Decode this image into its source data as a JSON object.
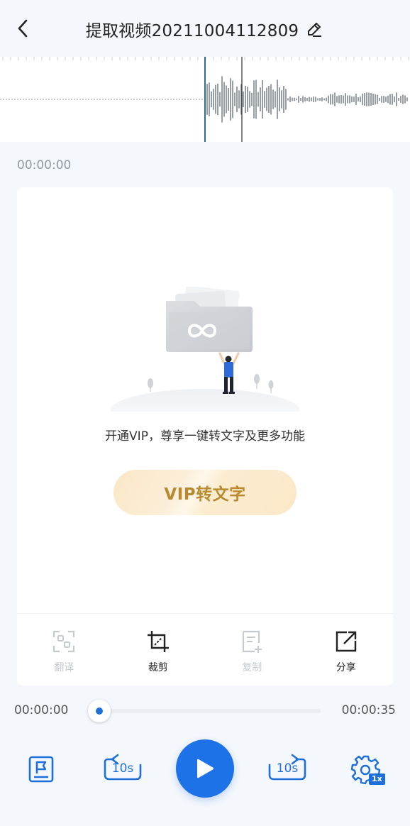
{
  "header": {
    "title": "提取视频20211004112809",
    "back_icon": "chevron-left-icon",
    "edit_icon": "pencil-icon"
  },
  "waveform": {
    "current_time": "00:00:00"
  },
  "promo": {
    "text": "开通VIP，尊享一键转文字及更多功能",
    "vip_button_label": "VIP转文字"
  },
  "toolbar": {
    "items": [
      {
        "label": "翻译",
        "icon": "translate-scan-icon",
        "enabled": false
      },
      {
        "label": "裁剪",
        "icon": "crop-icon",
        "enabled": true
      },
      {
        "label": "复制",
        "icon": "copy-document-icon",
        "enabled": false
      },
      {
        "label": "分享",
        "icon": "share-icon",
        "enabled": true
      }
    ]
  },
  "player": {
    "elapsed": "00:00:00",
    "duration": "00:00:35",
    "progress": 0,
    "rewind_label": "10s",
    "forward_label": "10s",
    "speed_badge": "1x"
  },
  "colors": {
    "accent": "#1e72e8",
    "vip_text": "#b8892f",
    "background": "#f4f7fb"
  }
}
